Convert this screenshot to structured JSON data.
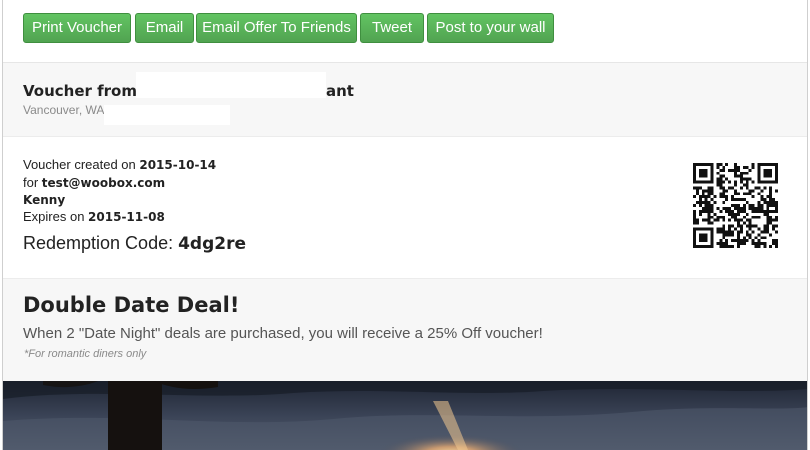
{
  "actions": {
    "print_voucher": "Print Voucher",
    "email": "Email",
    "email_offer_to_friends": "Email Offer To Friends",
    "tweet": "Tweet",
    "post_to_wall": "Post to your wall"
  },
  "merchant": {
    "title": "Voucher from Your Favorite Restaurant",
    "location": "Vancouver, WA"
  },
  "voucher": {
    "created_prefix": "Voucher created on ",
    "created_date": "2015-10-14",
    "for_prefix": "for ",
    "email": "test@woobox.com",
    "name": "Kenny",
    "expires_prefix": "Expires on ",
    "expires_date": "2015-11-08",
    "redemption_label": "Redemption Code: ",
    "redemption_code": "4dg2re"
  },
  "deal": {
    "title": "Double Date Deal!",
    "description": "When 2 \"Date Night\" deals are purchased, you will receive a 25% Off voucher!",
    "note": "*For romantic diners only"
  },
  "colors": {
    "button_green": "#5cb85c",
    "panel_gray": "#f7f7f7"
  }
}
